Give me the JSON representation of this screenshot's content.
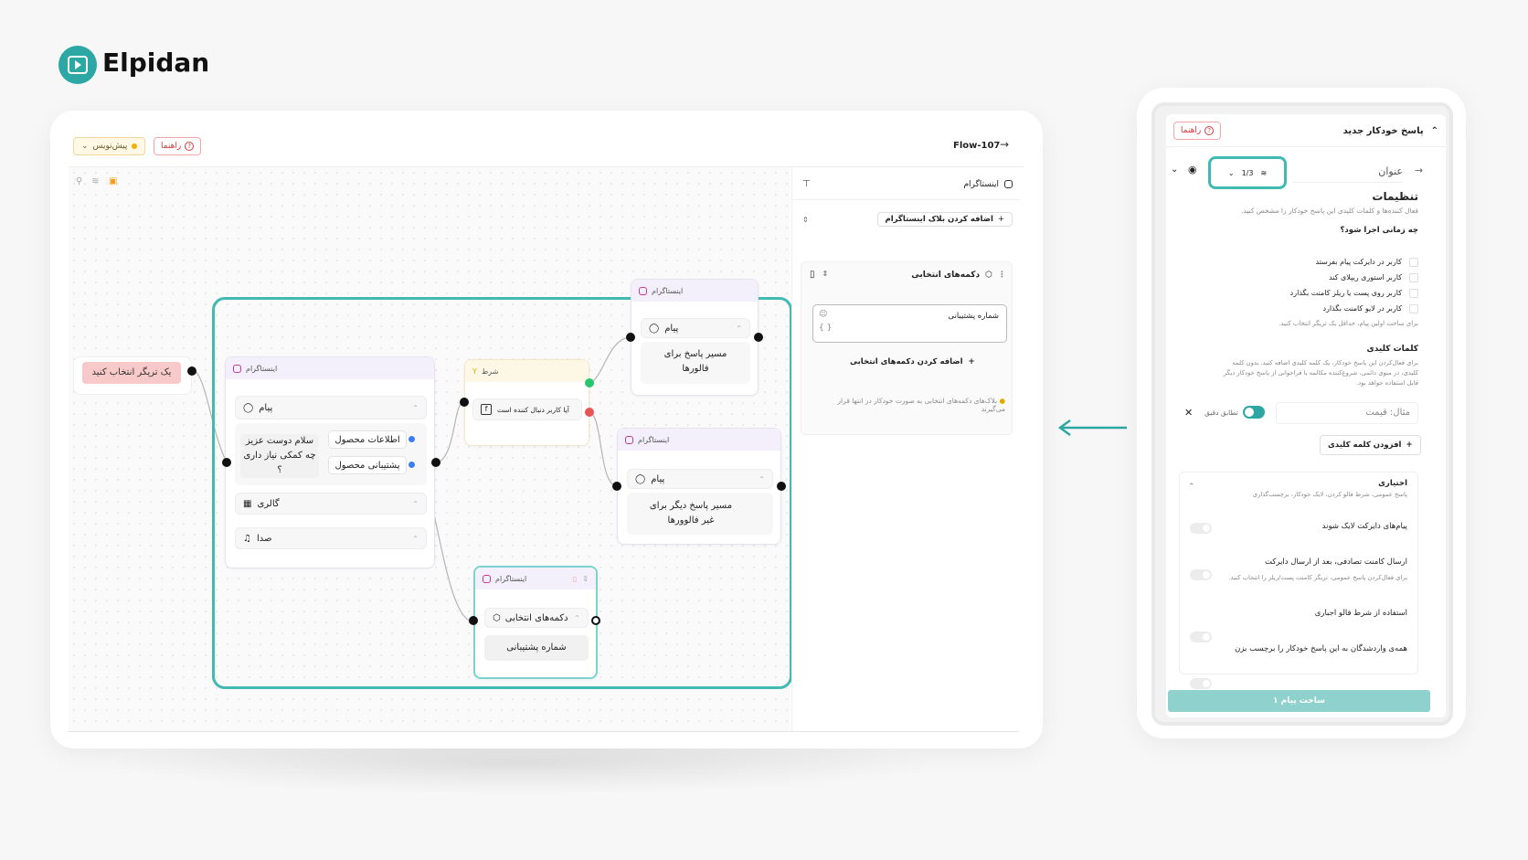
{
  "brand": {
    "name": "Elpidan"
  },
  "editor": {
    "draft_label": "پیش‌نویس",
    "guide_label": "راهنما",
    "flow_title": "Flow-107",
    "canvas_tools": [
      "key-icon",
      "layers-icon",
      "save-icon"
    ]
  },
  "trigger_node": {
    "label": "یک تریگر انتخاب کنید"
  },
  "nodes": {
    "instagram_main": {
      "platform": "اینستاگرام",
      "message_label": "پیام",
      "message_text_1": "سلام دوست عزیز",
      "message_text_2": "چه کمکی نیاز داری ؟",
      "button_1": "اطلاعات محصول",
      "button_2": "پشتیبانی محصول",
      "gallery_label": "گالری",
      "voice_label": "صدا"
    },
    "condition": {
      "title": "شرط",
      "rule": "آیا کاربر دنبال کننده است"
    },
    "instagram_followers": {
      "platform": "اینستاگرام",
      "message_label": "پیام",
      "text_1": "مسیر پاسخ برای",
      "text_2": "فالورها"
    },
    "instagram_nonfollowers": {
      "platform": "اینستاگرام",
      "message_label": "پیام",
      "text_1": "مسیر پاسخ دیگر برای",
      "text_2": "غیر فالوورها"
    },
    "instagram_buttons": {
      "platform": "اینستاگرام",
      "buttons_label": "دکمه‌های انتخابی",
      "option": "شماره پشتیبانی"
    }
  },
  "side_panel": {
    "title": "اینستاگرام",
    "add_block_label": "اضافه کردن بلاک اینستاگرام",
    "block_title": "دکمه‌های انتخابی",
    "input_value": "شماره پشتیبانی",
    "input_hint": "{ }",
    "add_buttons_label": "اضافه کردن دکمه‌های انتخابی",
    "tip_1": "بلاک‌های دکمه‌های انتخابی به صورت خودکار در انتها قرار",
    "tip_2": "می‌گیرند"
  },
  "autoreply": {
    "title": "پاسخ خودکار جدید",
    "guide_label": "راهنما",
    "name_placeholder": "عنوان",
    "pager": "1/3",
    "settings_title": "تنظیمات",
    "settings_desc": "فعال کننده‌ها و کلمات کلیدی این پاسخ خودکار را مشخص کنید.",
    "when_title": "چه زمانی اجرا شود؟",
    "when_options": [
      "کاربر در دایرکت پیام بفرستد",
      "کاربر استوری ریپلای کند",
      "کاربر روی پست یا ریلز کامنت بگذارد",
      "کاربر در لایو کامنت بگذارد"
    ],
    "when_note": "برای ساخت اولین پیام، حداقل یک تریگر انتخاب کنید.",
    "keywords_title": "کلمات کلیدی",
    "keywords_desc_1": "برای فعال‌کردن این پاسخ خودکار، یک کلمه کلیدی اضافه کنید. بدون کلمه",
    "keywords_desc_2": "کلیدی، در منوی دائمی، شروع‌کننده مکالمه یا فراخوانی از پاسخ خودکار دیگر",
    "keywords_desc_3": "قابل استفاده خواهد بود.",
    "keyword_placeholder": "مثال: قیمت",
    "exact_match": "تطابق دقیق",
    "add_keyword": "افزودن کلمه کلیدی",
    "optional_title": "اختیاری",
    "optional_desc": "پاسخ عمومی، شرط فالو کردن، لایک خودکار، برچسب‌گذاری",
    "opt_like_dm": "پیام‌های دایرکت لایک شوند",
    "opt_random_comment": "ارسال کامنت تصادفی، بعد از ارسال دایرکت",
    "opt_random_comment_note": "برای فعال‌کردن پاسخ عمومی، تریگر کامنت پست/ریلز را انتخاب کنید.",
    "opt_follow": "استفاده از شرط فالو اجباری",
    "opt_tag": "همه‌ی واردشدگان به این پاسخ خودکار را برچسب بزن",
    "create_button": "ساخت پیام ۱"
  },
  "colors": {
    "accent": "#2ca7a4",
    "selection": "#42b9b3",
    "trigger_bg": "#f8c9c9",
    "danger": "#d23c3c",
    "port_blue": "#3a7ef7",
    "port_green": "#28c76f",
    "port_red": "#ea5455"
  }
}
